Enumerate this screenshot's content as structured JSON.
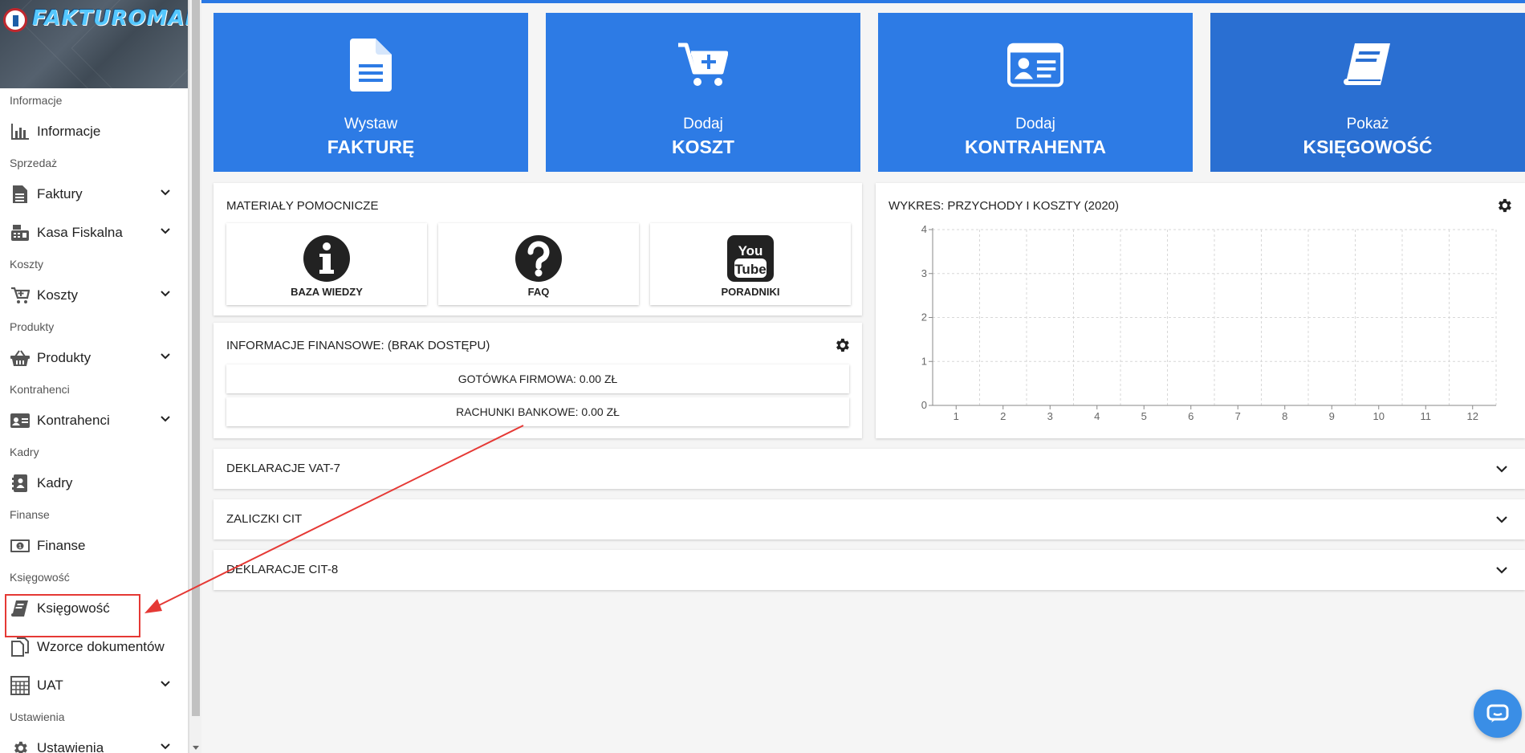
{
  "app": {
    "logo_text": "FAKTUROMANIA"
  },
  "sidebar": {
    "sections": [
      {
        "label": "Informacje",
        "items": [
          {
            "label": "Informacje",
            "icon": "bar-chart-icon",
            "expandable": false
          }
        ]
      },
      {
        "label": "Sprzedaż",
        "items": [
          {
            "label": "Faktury",
            "icon": "document-icon",
            "expandable": true
          },
          {
            "label": "Kasa Fiskalna",
            "icon": "cash-register-icon",
            "expandable": true
          }
        ]
      },
      {
        "label": "Koszty",
        "items": [
          {
            "label": "Koszty",
            "icon": "cart-icon",
            "expandable": true
          }
        ]
      },
      {
        "label": "Produkty",
        "items": [
          {
            "label": "Produkty",
            "icon": "basket-icon",
            "expandable": true
          }
        ]
      },
      {
        "label": "Kontrahenci",
        "items": [
          {
            "label": "Kontrahenci",
            "icon": "id-card-icon",
            "expandable": true
          }
        ]
      },
      {
        "label": "Kadry",
        "items": [
          {
            "label": "Kadry",
            "icon": "address-book-icon",
            "expandable": false
          }
        ]
      },
      {
        "label": "Finanse",
        "items": [
          {
            "label": "Finanse",
            "icon": "money-bill-icon",
            "expandable": false
          }
        ]
      },
      {
        "label": "Księgowość",
        "items": [
          {
            "label": "Księgowość",
            "icon": "book-icon",
            "expandable": false,
            "highlighted": true
          },
          {
            "label": "Wzorce dokumentów",
            "icon": "copy-icon",
            "expandable": false
          }
        ]
      },
      {
        "label": "",
        "items": [
          {
            "label": "UAT",
            "icon": "calculator-icon",
            "expandable": true
          }
        ]
      },
      {
        "label": "Ustawienia",
        "items": [
          {
            "label": "Ustawienia",
            "icon": "cog-icon",
            "expandable": true
          }
        ]
      }
    ]
  },
  "tiles": [
    {
      "line1": "Wystaw",
      "line2": "FAKTURĘ",
      "icon": "file-icon"
    },
    {
      "line1": "Dodaj",
      "line2": "KOSZT",
      "icon": "cart-plus-icon"
    },
    {
      "line1": "Dodaj",
      "line2": "KONTRAHENTA",
      "icon": "id-card-icon"
    },
    {
      "line1": "Pokaż",
      "line2": "KSIĘGOWOŚĆ",
      "icon": "book-icon"
    }
  ],
  "materials": {
    "title": "MATERIAŁY POMOCNICZE",
    "items": [
      {
        "label": "BAZA WIEDZY",
        "icon": "info-icon"
      },
      {
        "label": "FAQ",
        "icon": "question-icon"
      },
      {
        "label": "PORADNIKI",
        "icon": "youtube-icon"
      }
    ]
  },
  "finance": {
    "title": "INFORMACJE FINANSOWE: (BRAK DOSTĘPU)",
    "rows": [
      {
        "text": "GOTÓWKA FIRMOWA: 0.00 ZŁ"
      },
      {
        "text": "RACHUNKI BANKOWE: 0.00 ZŁ"
      }
    ]
  },
  "chart": {
    "title": "WYKRES: PRZYCHODY I KOSZTY (2020)"
  },
  "chart_data": {
    "type": "line",
    "title": "WYKRES: PRZYCHODY I KOSZTY (2020)",
    "x": [
      1,
      2,
      3,
      4,
      5,
      6,
      7,
      8,
      9,
      10,
      11,
      12
    ],
    "x_tick_labels": [
      "1",
      "2",
      "3",
      "4",
      "5",
      "6",
      "7",
      "8",
      "9",
      "10",
      "11",
      "12"
    ],
    "y_tick_labels": [
      "0",
      "1",
      "2",
      "3",
      "4"
    ],
    "ylim": [
      0,
      4
    ],
    "series": [],
    "grid": true
  },
  "accordions": [
    {
      "title": "DEKLARACJE VAT-7"
    },
    {
      "title": "ZALICZKI CIT"
    },
    {
      "title": "DEKLARACJE CIT-8"
    }
  ],
  "colors": {
    "tile_blue": "#2d7be5",
    "accent": "#2a78e4",
    "annotation_red": "#e53935"
  }
}
